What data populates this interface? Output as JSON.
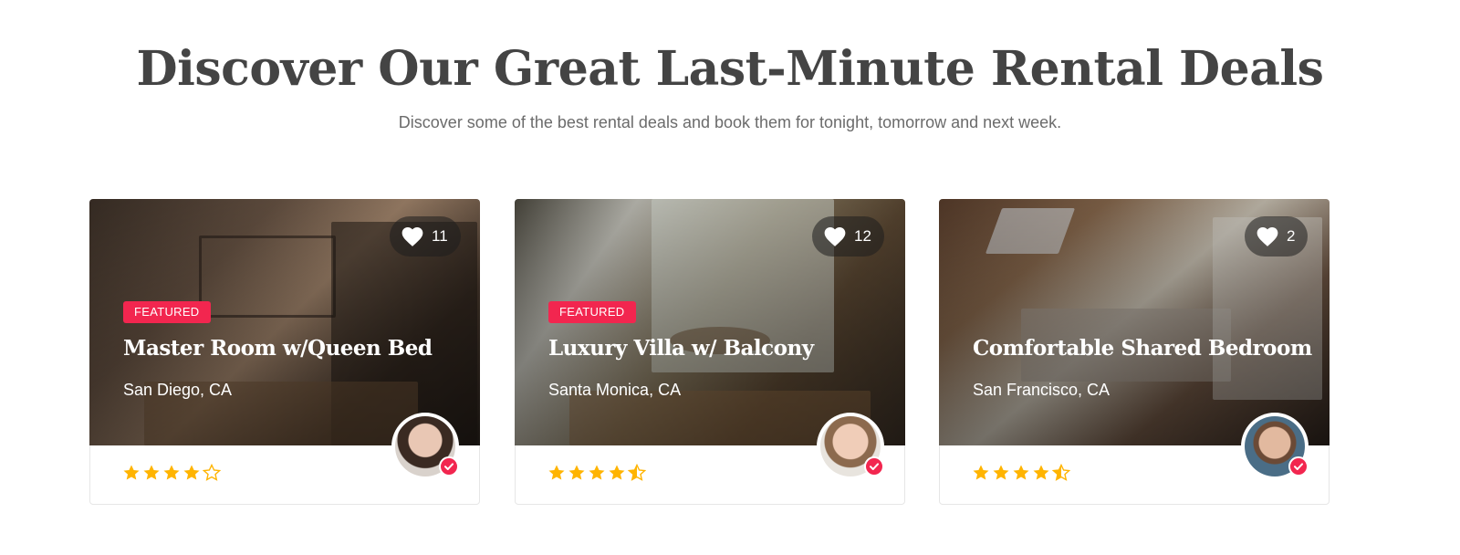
{
  "header": {
    "title": "Discover Our Great Last-Minute Rental Deals",
    "subtitle": "Discover some of the best rental deals and book them for tonight, tomorrow and next week."
  },
  "colors": {
    "accent": "#f2264f",
    "star": "#ffb400",
    "title": "#444444"
  },
  "listings": [
    {
      "likes": "11",
      "badge": "FEATURED",
      "title": "Master Room w/Queen Bed",
      "location": "San Diego, CA",
      "rating": 4,
      "star_icons": [
        "star-full-icon",
        "star-full-icon",
        "star-full-icon",
        "star-full-icon",
        "star-empty-icon"
      ]
    },
    {
      "likes": "12",
      "badge": "FEATURED",
      "title": "Luxury Villa w/ Balcony",
      "location": "Santa Monica, CA",
      "rating": 4.5,
      "star_icons": [
        "star-full-icon",
        "star-full-icon",
        "star-full-icon",
        "star-full-icon",
        "star-half-icon"
      ]
    },
    {
      "likes": "2",
      "badge": "",
      "title": "Comfortable Shared Bedroom",
      "location": "San Francisco, CA",
      "rating": 4.5,
      "star_icons": [
        "star-full-icon",
        "star-full-icon",
        "star-full-icon",
        "star-full-icon",
        "star-half-icon"
      ]
    }
  ]
}
